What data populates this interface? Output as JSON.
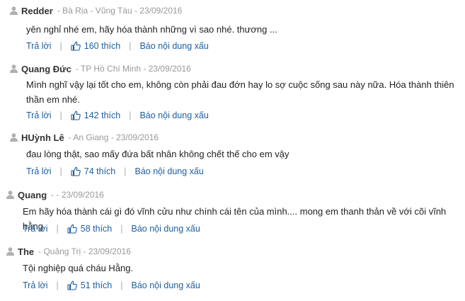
{
  "labels": {
    "reply": "Trả lời",
    "like_suffix": "thích",
    "report": "Báo nội dung xấu",
    "separator": "|"
  },
  "colors": {
    "link": "#1f5e9e",
    "meta": "#999999",
    "icon": "#b0b0b0"
  },
  "comments": [
    {
      "name": "Redder",
      "meta": "- Bà Rịa - Vũng Tàu - 23/09/2016",
      "text": "yên nghỉ nhé em, hãy hóa thành những vì sao nhé. thương ...",
      "likes": "160"
    },
    {
      "name": "Quang Đức",
      "meta": "- TP Hồ Chí Minh - 23/09/2016",
      "text": "Mình nghĩ vậy lại tốt cho em, không còn phải đau đớn hay lo sợ cuộc sống sau này nữa. Hóa thành thiên thần em nhé.",
      "likes": "142"
    },
    {
      "name": "HUỳnh Lê",
      "meta": "- An Giang - 23/09/2016",
      "text": "đau lòng thật, sao mấy đứa bất nhân không chết thế cho em vậy",
      "likes": "74"
    },
    {
      "name": "Quang",
      "meta": "- - 23/09/2016",
      "text": "Em hãy hóa thành cái gì đó vĩnh cửu như chính cái tên của mình.... mong em thanh thản về với cõi vĩnh hằng",
      "likes": "58"
    },
    {
      "name": "The",
      "meta": "- Quảng Trị - 23/09/2016",
      "text": "Tội nghiệp quá cháu Hằng.",
      "likes": "51"
    }
  ]
}
